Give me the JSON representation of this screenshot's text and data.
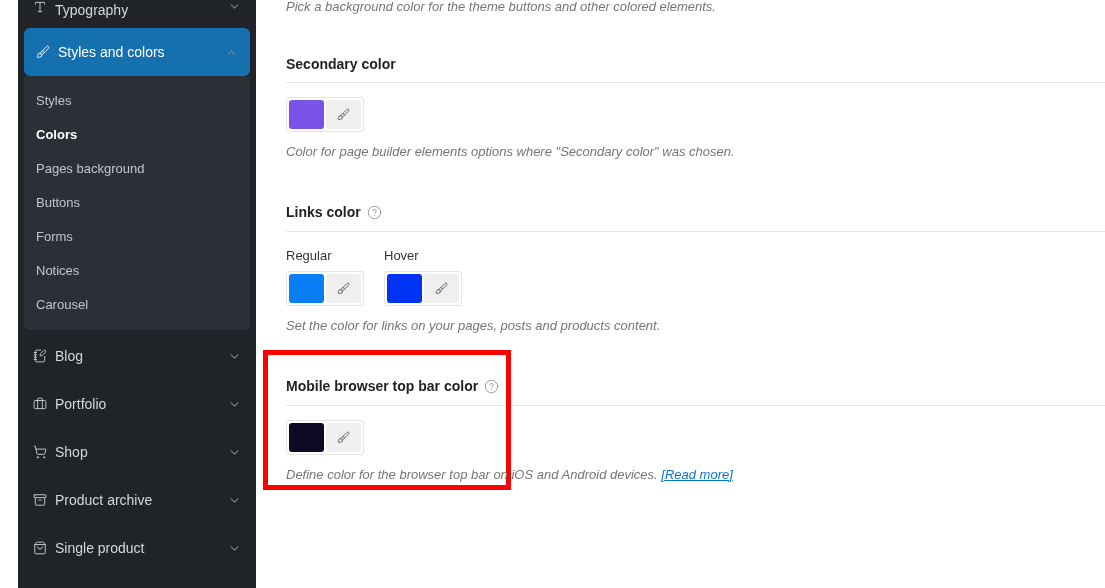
{
  "sidebar": {
    "items": [
      {
        "label": "Typography",
        "expanded": false,
        "selected": false
      },
      {
        "label": "Styles and colors",
        "expanded": true,
        "selected": true,
        "children": [
          {
            "label": "Styles",
            "selected": false
          },
          {
            "label": "Colors",
            "selected": true
          },
          {
            "label": "Pages background",
            "selected": false
          },
          {
            "label": "Buttons",
            "selected": false
          },
          {
            "label": "Forms",
            "selected": false
          },
          {
            "label": "Notices",
            "selected": false
          },
          {
            "label": "Carousel",
            "selected": false
          }
        ]
      },
      {
        "label": "Blog",
        "expanded": false,
        "selected": false
      },
      {
        "label": "Portfolio",
        "expanded": false,
        "selected": false
      },
      {
        "label": "Shop",
        "expanded": false,
        "selected": false
      },
      {
        "label": "Product archive",
        "expanded": false,
        "selected": false
      },
      {
        "label": "Single product",
        "expanded": false,
        "selected": false
      }
    ]
  },
  "content": {
    "intro": "Pick a background color for the theme buttons and other colored elements.",
    "sections": [
      {
        "title": "Secondary color",
        "help": false,
        "highlighted": false,
        "pickers": [
          {
            "color": "#7b52e8"
          }
        ],
        "description": "Color for page builder elements options where \"Secondary color\" was chosen."
      },
      {
        "title": "Links color",
        "help": true,
        "highlighted": false,
        "pickers": [
          {
            "label": "Regular",
            "color": "#0a7ff5"
          },
          {
            "label": "Hover",
            "color": "#0033f5"
          }
        ],
        "description": "Set the color for links on your pages, posts and products content."
      },
      {
        "title": "Mobile browser top bar color",
        "help": true,
        "highlighted": true,
        "pickers": [
          {
            "color": "#0e0a26"
          }
        ],
        "description": "Define color for the browser top bar on iOS and Android devices.",
        "link": "[Read more]"
      }
    ]
  }
}
